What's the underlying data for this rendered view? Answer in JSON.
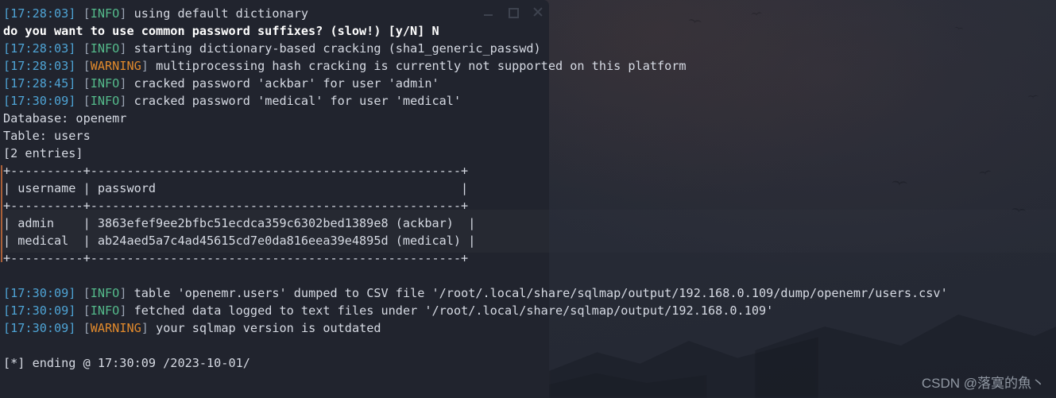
{
  "window": {
    "controls": {
      "minimize": "minimize",
      "maximize": "maximize",
      "close": "close"
    }
  },
  "terminal": {
    "lines": [
      {
        "type": "log",
        "timestamp": "[17:28:03]",
        "level": "INFO",
        "message": " using default dictionary"
      },
      {
        "type": "prompt",
        "text": "do you want to use common password suffixes? (slow!) [y/N] N"
      },
      {
        "type": "log",
        "timestamp": "[17:28:03]",
        "level": "INFO",
        "message": " starting dictionary-based cracking (sha1_generic_passwd)"
      },
      {
        "type": "log",
        "timestamp": "[17:28:03]",
        "level": "WARNING",
        "message": " multiprocessing hash cracking is currently not supported on this platform"
      },
      {
        "type": "log",
        "timestamp": "[17:28:45]",
        "level": "INFO",
        "message": " cracked password 'ackbar' for user 'admin'"
      },
      {
        "type": "log",
        "timestamp": "[17:30:09]",
        "level": "INFO",
        "message": " cracked password 'medical' for user 'medical'"
      },
      {
        "type": "plain",
        "text": "Database: openemr"
      },
      {
        "type": "plain",
        "text": "Table: users"
      },
      {
        "type": "plain",
        "text": "[2 entries]"
      },
      {
        "type": "plain",
        "text": "+----------+---------------------------------------------------+"
      },
      {
        "type": "plain",
        "text": "| username | password                                          |"
      },
      {
        "type": "plain",
        "text": "+----------+---------------------------------------------------+"
      },
      {
        "type": "plain",
        "text": "| admin    | 3863efef9ee2bfbc51ecdca359c6302bed1389e8 (ackbar)  |"
      },
      {
        "type": "plain",
        "text": "| medical  | ab24aed5a7c4ad45615cd7e0da816eea39e4895d (medical) |"
      },
      {
        "type": "plain",
        "text": "+----------+---------------------------------------------------+"
      },
      {
        "type": "blank",
        "text": ""
      },
      {
        "type": "log",
        "timestamp": "[17:30:09]",
        "level": "INFO",
        "message": " table 'openemr.users' dumped to CSV file '/root/.local/share/sqlmap/output/192.168.0.109/dump/openemr/users.csv'"
      },
      {
        "type": "log",
        "timestamp": "[17:30:09]",
        "level": "INFO",
        "message": " fetched data logged to text files under '/root/.local/share/sqlmap/output/192.168.0.109'"
      },
      {
        "type": "log",
        "timestamp": "[17:30:09]",
        "level": "WARNING",
        "message": " your sqlmap version is outdated"
      },
      {
        "type": "blank",
        "text": ""
      },
      {
        "type": "ending",
        "text": "[*] ending @ 17:30:09 /2023-10-01/"
      }
    ],
    "dump": {
      "database_label": "Database: openemr",
      "database": "openemr",
      "table_label": "Table: users",
      "table": "users",
      "entries_label": "[2 entries]",
      "entries": 2,
      "columns": [
        "username",
        "password"
      ],
      "rows": [
        {
          "username": "admin",
          "password_hash": "3863efef9ee2bfbc51ecdca359c6302bed1389e8",
          "password_plain": "ackbar"
        },
        {
          "username": "medical",
          "password_hash": "ab24aed5a7c4ad45615cd7e0da816eea39e4895d",
          "password_plain": "medical"
        }
      ]
    },
    "colors": {
      "background": "#21242e",
      "foreground": "#d6dae3",
      "timestamp": "#4ea3d4",
      "info": "#54b98a",
      "warning": "#e0892c",
      "bracket": "#9aa3b2",
      "accent_strip": "#b3643a"
    }
  },
  "watermark": {
    "text": "CSDN @落寞的魚丶"
  }
}
